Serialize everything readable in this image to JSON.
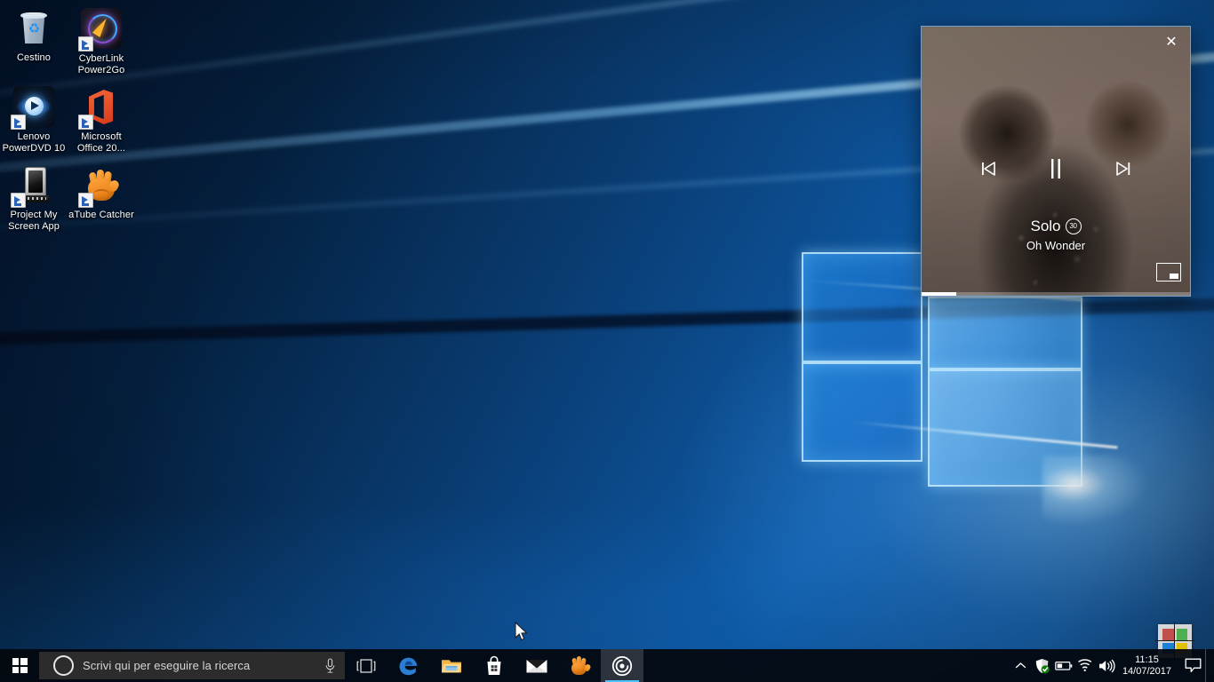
{
  "desktop": {
    "wallpaper_name": "windows-10-hero-wallpaper",
    "icons": [
      {
        "label": "Cestino",
        "icon": "recycle-bin-icon",
        "shortcut": false
      },
      {
        "label": "CyberLink Power2Go",
        "icon": "cyberlink-power2go-icon",
        "shortcut": true
      },
      {
        "label": "Lenovo PowerDVD 10",
        "icon": "lenovo-powerdvd-icon",
        "shortcut": true
      },
      {
        "label": "Microsoft Office 20...",
        "icon": "microsoft-office-icon",
        "shortcut": true
      },
      {
        "label": "Project My Screen App",
        "icon": "project-my-screen-icon",
        "shortcut": true
      },
      {
        "label": "aTube Catcher",
        "icon": "atube-catcher-icon",
        "shortcut": true
      }
    ]
  },
  "media_popup": {
    "app": "groove-music",
    "close_label": "✕",
    "track_title": "Solo",
    "explicit_badge": "30",
    "artist": "Oh Wonder",
    "controls": {
      "previous": "previous-track",
      "playpause": "pause",
      "next": "next-track"
    },
    "miniview_label": "mini-view",
    "progress_percent": 13,
    "art_accent": "#7b6b5e"
  },
  "taskbar": {
    "start_label": "Start",
    "search": {
      "placeholder": "Scrivi qui per eseguire la ricerca",
      "value": "",
      "cortana_icon": "cortana-circle-icon",
      "mic_icon": "microphone-icon"
    },
    "apps": [
      {
        "name": "task-view",
        "label": "Visualizzazione attività",
        "active": false
      },
      {
        "name": "microsoft-edge",
        "label": "Microsoft Edge",
        "active": false
      },
      {
        "name": "file-explorer",
        "label": "Esplora file",
        "active": false
      },
      {
        "name": "microsoft-store",
        "label": "Microsoft Store",
        "active": false
      },
      {
        "name": "mail",
        "label": "Posta",
        "active": false
      },
      {
        "name": "atube-catcher",
        "label": "aTube Catcher",
        "active": false
      },
      {
        "name": "groove-music",
        "label": "Groove Musica",
        "active": true
      }
    ],
    "tray": [
      {
        "name": "show-hidden-icons",
        "label": "Mostra icone nascoste",
        "glyph": "chevron-up-icon"
      },
      {
        "name": "windows-defender",
        "label": "Windows Defender",
        "glyph": "shield-icon"
      },
      {
        "name": "battery",
        "label": "Batteria",
        "glyph": "battery-icon"
      },
      {
        "name": "network",
        "label": "Rete",
        "glyph": "wifi-icon"
      },
      {
        "name": "volume",
        "label": "Volume",
        "glyph": "speaker-icon"
      }
    ],
    "clock": {
      "time": "11:15",
      "date": "14/07/2017"
    },
    "action_center_label": "Centro notifiche"
  },
  "overlay": {
    "capture_tool": "screen-capture-crosshair"
  },
  "colors": {
    "taskbar": "#03070e",
    "accent": "#4cc2ff",
    "search_box": "#2c2c2c",
    "desktop_blue": "#0e5ba8"
  }
}
